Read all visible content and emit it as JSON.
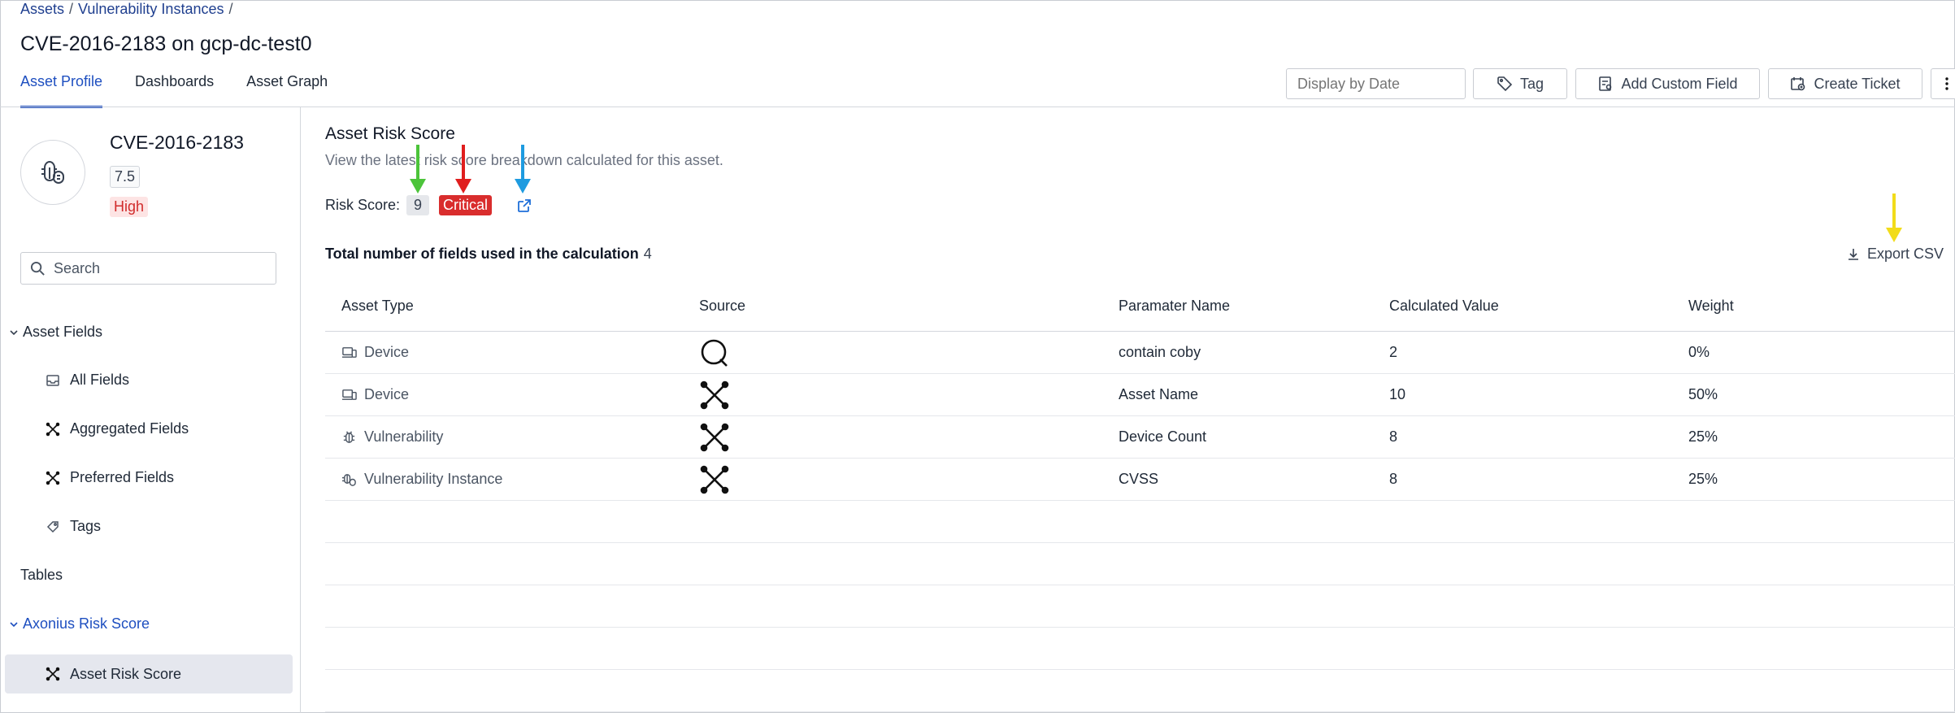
{
  "breadcrumb": {
    "item1": "Assets",
    "item2": "Vulnerability Instances",
    "sep": "/"
  },
  "page_title": "CVE-2016-2183 on gcp-dc-test0",
  "tabs": [
    {
      "label": "Asset Profile",
      "active": true
    },
    {
      "label": "Dashboards",
      "active": false
    },
    {
      "label": "Asset Graph",
      "active": false
    }
  ],
  "toolbar": {
    "date_placeholder": "Display by Date",
    "tag_label": "Tag",
    "custom_field_label": "Add Custom Field",
    "ticket_label": "Create Ticket"
  },
  "sidebar": {
    "asset_name": "CVE-2016-2183",
    "score": "7.5",
    "severity": "High",
    "search_placeholder": "Search",
    "groups": {
      "asset_fields": "Asset Fields",
      "tables": "Tables",
      "risk_score": "Axonius Risk Score"
    },
    "items": {
      "all_fields": "All Fields",
      "aggregated_fields": "Aggregated Fields",
      "preferred_fields": "Preferred Fields",
      "tags": "Tags",
      "asset_risk_score": "Asset Risk Score"
    }
  },
  "main": {
    "title": "Asset Risk Score",
    "description": "View the latest risk score breakdown calculated for this asset.",
    "risk_label": "Risk Score:",
    "risk_value": "9",
    "risk_level": "Critical",
    "total_label": "Total number of fields used in the calculation",
    "total_count": "4",
    "export_label": "Export CSV"
  },
  "table": {
    "headers": [
      "Asset Type",
      "Source",
      "Paramater Name",
      "Calculated Value",
      "Weight"
    ],
    "rows": [
      {
        "type": "Device",
        "type_icon": "device-icon",
        "source_icon": "q-source-icon",
        "param": "contain coby",
        "value": "2",
        "weight": "0%"
      },
      {
        "type": "Device",
        "type_icon": "device-icon",
        "source_icon": "axonius-x-icon",
        "param": "Asset Name",
        "value": "10",
        "weight": "50%"
      },
      {
        "type": "Vulnerability",
        "type_icon": "bug-icon",
        "source_icon": "axonius-x-icon",
        "param": "Device Count",
        "value": "8",
        "weight": "25%"
      },
      {
        "type": "Vulnerability Instance",
        "type_icon": "bug-instance-icon",
        "source_icon": "axonius-x-icon",
        "param": "CVSS",
        "value": "8",
        "weight": "25%"
      }
    ]
  },
  "colors": {
    "accent": "#1e4fc0",
    "critical": "#d92d2d",
    "high_text": "#d12b2b",
    "arrow_green": "#4cc43a",
    "arrow_red": "#e01e1e",
    "arrow_blue": "#1e9be0",
    "arrow_yellow": "#f2dc1a"
  }
}
